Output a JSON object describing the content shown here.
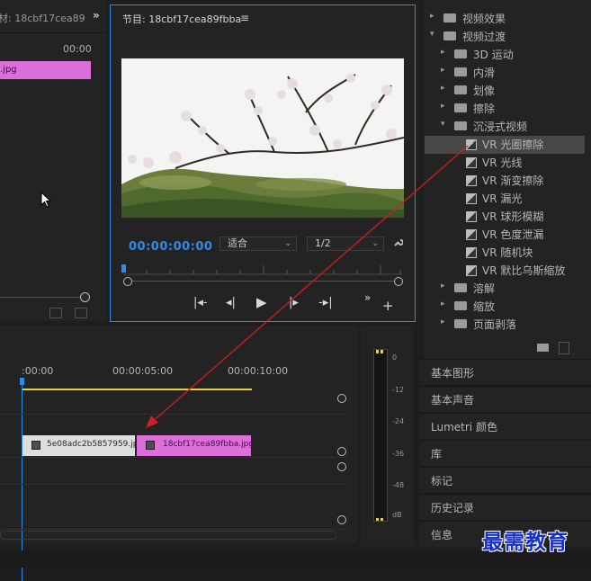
{
  "source": {
    "title": "材: 18cbf17cea89",
    "more_icon": "»",
    "timecode": "00:00",
    "clip_label": ".jpg"
  },
  "program": {
    "title": "节目: 18cbf17cea89fbba",
    "menu_icon": "≡",
    "timecode": "00:00:00:00",
    "fit_value": "适合",
    "resolution_value": "1/2",
    "dropdown_arrow": "⌄"
  },
  "effects": {
    "items": [
      {
        "label": "视频效果",
        "level": 0,
        "type": "folder"
      },
      {
        "label": "视频过渡",
        "level": 0,
        "type": "folder",
        "open": true
      },
      {
        "label": "3D 运动",
        "level": 1,
        "type": "folder"
      },
      {
        "label": "内滑",
        "level": 1,
        "type": "folder"
      },
      {
        "label": "划像",
        "level": 1,
        "type": "folder"
      },
      {
        "label": "擦除",
        "level": 1,
        "type": "folder"
      },
      {
        "label": "沉浸式视频",
        "level": 1,
        "type": "folder",
        "open": true
      },
      {
        "label": "VR 光圈擦除",
        "level": 2,
        "type": "effect",
        "selected": true
      },
      {
        "label": "VR 光线",
        "level": 2,
        "type": "effect"
      },
      {
        "label": "VR 渐变擦除",
        "level": 2,
        "type": "effect"
      },
      {
        "label": "VR 漏光",
        "level": 2,
        "type": "effect"
      },
      {
        "label": "VR 球形模糊",
        "level": 2,
        "type": "effect"
      },
      {
        "label": "VR 色度泄漏",
        "level": 2,
        "type": "effect"
      },
      {
        "label": "VR 随机块",
        "level": 2,
        "type": "effect"
      },
      {
        "label": "VR 默比乌斯缩放",
        "level": 2,
        "type": "effect"
      },
      {
        "label": "溶解",
        "level": 1,
        "type": "folder"
      },
      {
        "label": "缩放",
        "level": 1,
        "type": "folder"
      },
      {
        "label": "页面剥落",
        "level": 1,
        "type": "folder"
      }
    ]
  },
  "panels": [
    "基本图形",
    "基本声音",
    "Lumetri 颜色",
    "库",
    "标记",
    "历史记录",
    "信息"
  ],
  "timeline": {
    "times": [
      ":00:00",
      "00:00:05:00",
      "00:00:10:00"
    ],
    "clips": [
      "5e08adc2b5857959.jp",
      "18cbf17cea89fbba.jpg"
    ]
  },
  "meter": {
    "db_labels": [
      "0",
      "-12",
      "-24",
      "-36",
      "-48",
      "dB"
    ]
  },
  "watermark": "最需教育",
  "colors": {
    "accent": "#2d8ceb",
    "clip_pink": "#dd6fdb",
    "work_area": "#e6d13f",
    "annotation": "#d01f1f"
  }
}
